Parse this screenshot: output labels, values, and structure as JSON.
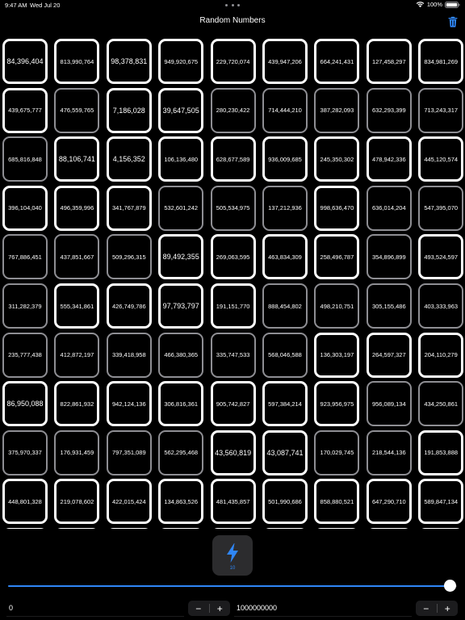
{
  "status": {
    "time": "9:47 AM",
    "date": "Wed Jul 20",
    "battery": "100%"
  },
  "nav": {
    "title": "Random Numbers",
    "trash_icon": "trash-icon"
  },
  "colors": {
    "accent": "#2f86f6",
    "thick_border": "#ffffff",
    "thin_border": "#8e8e93",
    "background": "#000000"
  },
  "grid": {
    "columns": 9,
    "rows": [
      [
        {
          "v": "84,396,404",
          "s": "tb"
        },
        {
          "v": "813,990,764",
          "s": "t"
        },
        {
          "v": "98,378,831",
          "s": "tb"
        },
        {
          "v": "949,920,675",
          "s": "t"
        },
        {
          "v": "229,720,074",
          "s": "t"
        },
        {
          "v": "439,947,206",
          "s": "t"
        },
        {
          "v": "664,241,431",
          "s": "t"
        },
        {
          "v": "127,458,297",
          "s": "t"
        },
        {
          "v": "834,981,269",
          "s": "t"
        }
      ],
      [
        {
          "v": "439,675,777",
          "s": "t"
        },
        {
          "v": "476,559,765",
          "s": "g"
        },
        {
          "v": "7,186,028",
          "s": "tb"
        },
        {
          "v": "39,647,505",
          "s": "tb"
        },
        {
          "v": "280,230,422",
          "s": "g"
        },
        {
          "v": "714,444,210",
          "s": "g"
        },
        {
          "v": "387,282,093",
          "s": "g"
        },
        {
          "v": "632,293,399",
          "s": "g"
        },
        {
          "v": "713,243,317",
          "s": "g"
        }
      ],
      [
        {
          "v": "685,816,848",
          "s": "g"
        },
        {
          "v": "88,106,741",
          "s": "tb"
        },
        {
          "v": "4,156,352",
          "s": "tb"
        },
        {
          "v": "106,136,480",
          "s": "t"
        },
        {
          "v": "628,677,589",
          "s": "t"
        },
        {
          "v": "936,009,685",
          "s": "t"
        },
        {
          "v": "245,350,302",
          "s": "t"
        },
        {
          "v": "478,942,336",
          "s": "t"
        },
        {
          "v": "445,120,574",
          "s": "t"
        }
      ],
      [
        {
          "v": "396,104,040",
          "s": "t"
        },
        {
          "v": "496,359,996",
          "s": "t"
        },
        {
          "v": "341,767,879",
          "s": "t"
        },
        {
          "v": "532,601,242",
          "s": "g"
        },
        {
          "v": "505,534,975",
          "s": "g"
        },
        {
          "v": "137,212,936",
          "s": "g"
        },
        {
          "v": "998,636,470",
          "s": "t"
        },
        {
          "v": "636,014,204",
          "s": "g"
        },
        {
          "v": "547,395,070",
          "s": "g"
        }
      ],
      [
        {
          "v": "767,886,451",
          "s": "g"
        },
        {
          "v": "437,851,667",
          "s": "g"
        },
        {
          "v": "509,296,315",
          "s": "g"
        },
        {
          "v": "89,492,355",
          "s": "tb"
        },
        {
          "v": "269,063,595",
          "s": "t"
        },
        {
          "v": "463,834,309",
          "s": "t"
        },
        {
          "v": "258,496,787",
          "s": "t"
        },
        {
          "v": "354,896,899",
          "s": "g"
        },
        {
          "v": "493,524,597",
          "s": "t"
        }
      ],
      [
        {
          "v": "311,282,379",
          "s": "g"
        },
        {
          "v": "555,341,861",
          "s": "t"
        },
        {
          "v": "426,749,786",
          "s": "t"
        },
        {
          "v": "97,793,797",
          "s": "tb"
        },
        {
          "v": "191,151,770",
          "s": "t"
        },
        {
          "v": "888,454,802",
          "s": "g"
        },
        {
          "v": "498,210,751",
          "s": "g"
        },
        {
          "v": "305,155,486",
          "s": "g"
        },
        {
          "v": "403,333,963",
          "s": "g"
        }
      ],
      [
        {
          "v": "235,777,438",
          "s": "g"
        },
        {
          "v": "412,872,197",
          "s": "g"
        },
        {
          "v": "339,418,958",
          "s": "g"
        },
        {
          "v": "466,380,365",
          "s": "g"
        },
        {
          "v": "335,747,533",
          "s": "g"
        },
        {
          "v": "568,046,588",
          "s": "g"
        },
        {
          "v": "136,303,197",
          "s": "t"
        },
        {
          "v": "264,597,327",
          "s": "t"
        },
        {
          "v": "204,110,279",
          "s": "t"
        }
      ],
      [
        {
          "v": "86,950,088",
          "s": "tb"
        },
        {
          "v": "822,861,932",
          "s": "t"
        },
        {
          "v": "942,124,136",
          "s": "t"
        },
        {
          "v": "306,816,361",
          "s": "t"
        },
        {
          "v": "905,742,827",
          "s": "t"
        },
        {
          "v": "597,384,214",
          "s": "t"
        },
        {
          "v": "923,956,975",
          "s": "t"
        },
        {
          "v": "956,089,134",
          "s": "g"
        },
        {
          "v": "434,250,861",
          "s": "g"
        }
      ],
      [
        {
          "v": "375,970,337",
          "s": "g"
        },
        {
          "v": "176,931,459",
          "s": "g"
        },
        {
          "v": "797,351,089",
          "s": "g"
        },
        {
          "v": "562,295,468",
          "s": "g"
        },
        {
          "v": "43,560,819",
          "s": "tb"
        },
        {
          "v": "43,087,741",
          "s": "tb"
        },
        {
          "v": "170,029,745",
          "s": "g"
        },
        {
          "v": "218,544,136",
          "s": "g"
        },
        {
          "v": "191,853,888",
          "s": "t"
        }
      ],
      [
        {
          "v": "448,801,328",
          "s": "t"
        },
        {
          "v": "219,078,602",
          "s": "t"
        },
        {
          "v": "422,015,424",
          "s": "t"
        },
        {
          "v": "134,863,526",
          "s": "t"
        },
        {
          "v": "481,435,857",
          "s": "t"
        },
        {
          "v": "501,990,686",
          "s": "t"
        },
        {
          "v": "858,880,521",
          "s": "t"
        },
        {
          "v": "647,290,710",
          "s": "t"
        },
        {
          "v": "589,847,134",
          "s": "t"
        }
      ],
      [
        {
          "v": "",
          "s": "t"
        },
        {
          "v": "",
          "s": "t"
        },
        {
          "v": "",
          "s": "t"
        },
        {
          "v": "",
          "s": "t"
        },
        {
          "v": "",
          "s": "t"
        },
        {
          "v": "",
          "s": "t"
        },
        {
          "v": "",
          "s": "t"
        },
        {
          "v": "",
          "s": "t"
        },
        {
          "v": "",
          "s": "t"
        }
      ]
    ]
  },
  "generate": {
    "icon": "bolt-icon",
    "count": "10"
  },
  "slider": {
    "value_fraction": 1.0
  },
  "range": {
    "min_value": "0",
    "max_value": "1000000000",
    "minus_label": "−",
    "plus_label": "+"
  }
}
